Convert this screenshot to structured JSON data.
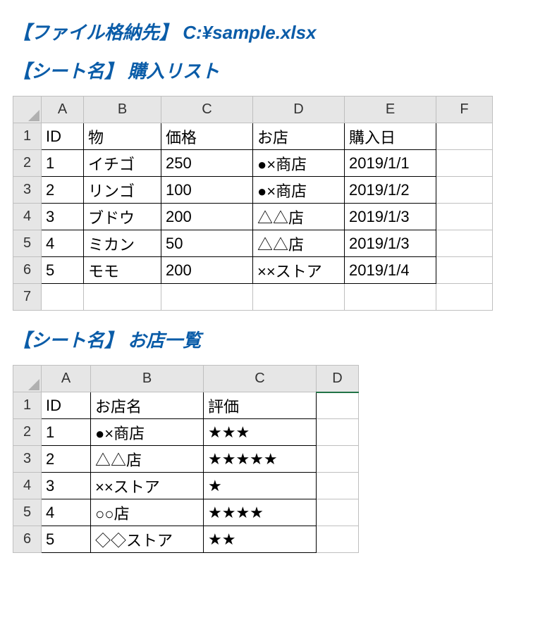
{
  "file_location": {
    "label": "【ファイル格納先】",
    "value": "C:¥sample.xlsx"
  },
  "sheets": [
    {
      "label": "【シート名】",
      "name": "購入リスト",
      "columns": [
        "A",
        "B",
        "C",
        "D",
        "E",
        "F"
      ],
      "row_count": 7,
      "headers": [
        "ID",
        "物",
        "価格",
        "お店",
        "購入日"
      ],
      "rows": [
        {
          "id": "1",
          "item": "イチゴ",
          "price": "250",
          "store": "●×商店",
          "date": "2019/1/1"
        },
        {
          "id": "2",
          "item": "リンゴ",
          "price": "100",
          "store": "●×商店",
          "date": "2019/1/2"
        },
        {
          "id": "3",
          "item": "ブドウ",
          "price": "200",
          "store": "△△店",
          "date": "2019/1/3"
        },
        {
          "id": "4",
          "item": "ミカン",
          "price": "50",
          "store": "△△店",
          "date": "2019/1/3"
        },
        {
          "id": "5",
          "item": "モモ",
          "price": "200",
          "store": "××ストア",
          "date": "2019/1/4"
        }
      ]
    },
    {
      "label": "【シート名】",
      "name": "お店一覧",
      "columns": [
        "A",
        "B",
        "C",
        "D"
      ],
      "row_count": 6,
      "headers": [
        "ID",
        "お店名",
        "評価"
      ],
      "rows": [
        {
          "id": "1",
          "store": "●×商店",
          "rating": "★★★"
        },
        {
          "id": "2",
          "store": "△△店",
          "rating": "★★★★★"
        },
        {
          "id": "3",
          "store": "××ストア",
          "rating": "★"
        },
        {
          "id": "4",
          "store": "○○店",
          "rating": "★★★★"
        },
        {
          "id": "5",
          "store": "◇◇ストア",
          "rating": "★★"
        }
      ]
    }
  ]
}
